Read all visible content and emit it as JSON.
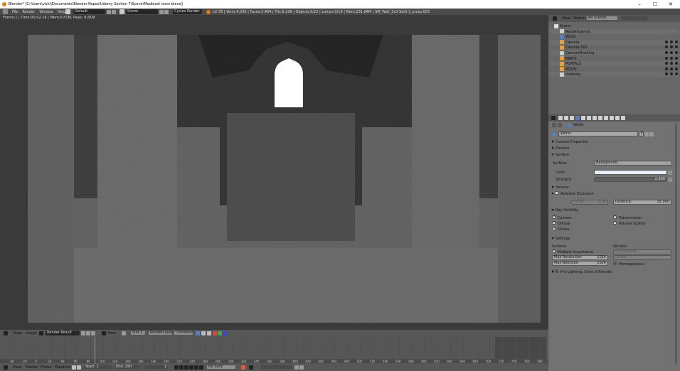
{
  "window": {
    "title": "Blender* [C:\\Users\\vicki\\Documents\\Blender Repos\\Udemy Section 7\\Scene\\Medieval room.blend]",
    "min": "–",
    "max": "☐",
    "close": "✕"
  },
  "menu": {
    "items": [
      "File",
      "Render",
      "Window",
      "Help"
    ]
  },
  "header": {
    "screen": "Default",
    "scene": "Scene",
    "engine": "Cycles Render",
    "stats": "v2.78 | Verts:4,266 | Faces:3,464 | Tris:8,106 | Objects:0/22 | Lamps:0/19 | Mem:231.84M | SM_Wall_3x3 Set3.3_proxy.003"
  },
  "render": {
    "status": "Frame:1 | Time:00:02.14 | Mem:0.81M, Peak: 9.81M"
  },
  "image_editor": {
    "menus": [
      "View",
      "Image"
    ],
    "image": "Render Result",
    "view_menu": "View",
    "slot": "Slot 2",
    "layer": "RenderLayer",
    "pass": "Combined"
  },
  "timeline": {
    "ticks": [
      "-40",
      "-20",
      "0",
      "20",
      "40",
      "60",
      "80",
      "100",
      "120",
      "140",
      "160",
      "180",
      "200",
      "220",
      "240",
      "260",
      "280",
      "300",
      "320",
      "340",
      "360",
      "380",
      "400",
      "420",
      "440",
      "460",
      "480",
      "500",
      "520",
      "540",
      "560",
      "580",
      "600",
      "620",
      "640",
      "660",
      "680",
      "700",
      "720",
      "740",
      "760",
      "780"
    ],
    "menus": [
      "View",
      "Marker",
      "Frame",
      "Playback"
    ],
    "start_label": "Start:",
    "start": "1",
    "end_label": "End:",
    "end": "250",
    "current": "1",
    "sync": "No Sync"
  },
  "outliner": {
    "menus": [
      "View",
      "Search"
    ],
    "display": "All Scenes",
    "items": [
      {
        "name": "Scene",
        "depth": 0,
        "icon": "scene-icon"
      },
      {
        "name": "RenderLayers",
        "depth": 1,
        "icon": "renderlayer-icon"
      },
      {
        "name": "World",
        "depth": 1,
        "icon": "world-icon"
      },
      {
        "name": "Camera",
        "depth": 1,
        "icon": "camera-icon"
      },
      {
        "name": "Camera.001",
        "depth": 1,
        "icon": "camera-icon"
      },
      {
        "name": "CameraTracking",
        "depth": 1,
        "icon": "object-icon"
      },
      {
        "name": "PARTS",
        "depth": 1,
        "icon": "group-icon"
      },
      {
        "name": "PORTALS",
        "depth": 1,
        "icon": "group-icon"
      },
      {
        "name": "ROOM",
        "depth": 1,
        "icon": "group-icon"
      },
      {
        "name": "meteorg",
        "depth": 1,
        "icon": "object-icon"
      }
    ]
  },
  "properties": {
    "breadcrumb": "World",
    "world_name": "World",
    "world_users": "F",
    "panels": {
      "custom_properties": "Custom Properties",
      "preview": "Preview",
      "surface": "Surface",
      "volume": "Volume",
      "ambient_occlusion": "Ambient Occlusion",
      "ray_visibility": "Ray Visibility",
      "settings": "Settings",
      "pro_lighting": "Pro-Lighting: Skies (Ultimate)"
    },
    "surface_label": "Surface:",
    "surface_value": "Background",
    "color_label": "Color:",
    "color_value": "#e8eef4",
    "strength_label": "Strength:",
    "strength_value": "2.300",
    "ao_factor_label": "Factor:",
    "ao_factor_value": "1.00",
    "ao_distance_label": "Distance:",
    "ao_distance_value": "15.000",
    "ray": {
      "camera": "Camera",
      "diffuse": "Diffuse",
      "glossy": "Glossy",
      "transmission": "Transmission",
      "volume_scatter": "Volume Scatter"
    },
    "settings_surface_label": "Surface:",
    "settings_volume_label": "Volume:",
    "multiple_importance": "Multiple Importance",
    "max_resolution_label": "Max Resolution:",
    "max_resolution_value": "1024",
    "max_bounces_label": "Max Bounces:",
    "max_bounces_value": "1024",
    "volume_sampling": "Equiangular",
    "volume_interp": "Linear",
    "homogeneous": "Homogeneous"
  },
  "colors": {
    "accent": "#5680c2",
    "playhead": "#2fdc2f",
    "panel": "#727272"
  }
}
